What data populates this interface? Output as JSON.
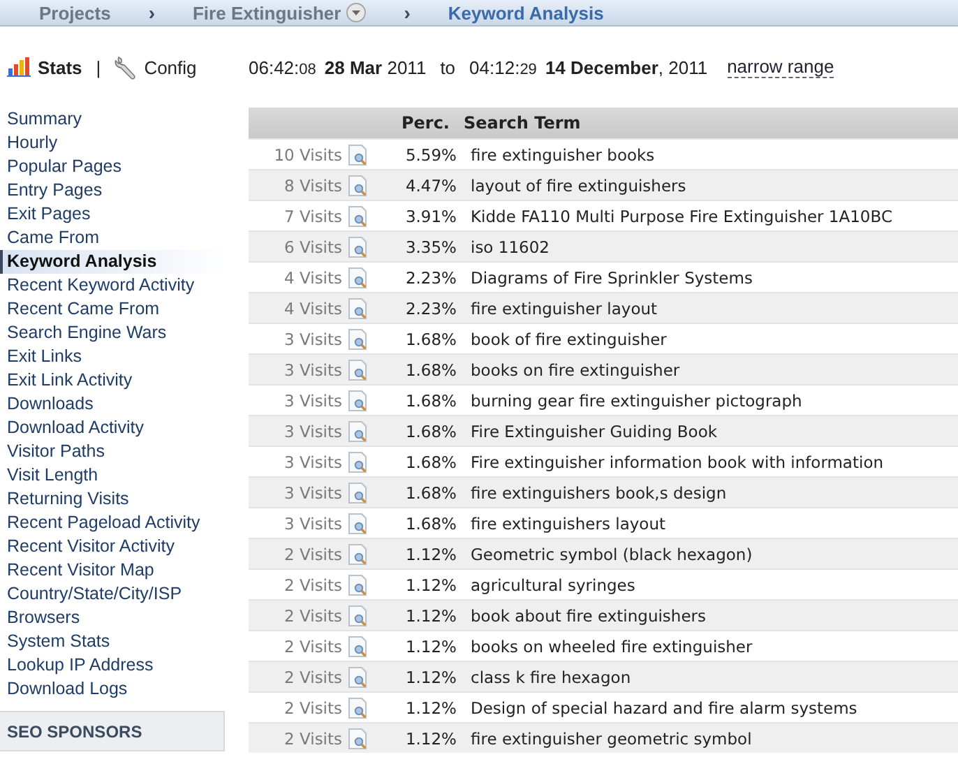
{
  "breadcrumb": [
    {
      "label": "Projects",
      "dropdown": false,
      "selected": false
    },
    {
      "label": "Fire Extinguisher",
      "dropdown": true,
      "selected": false
    },
    {
      "label": "Keyword Analysis",
      "dropdown": false,
      "selected": true
    }
  ],
  "separator": "›",
  "toolbar": {
    "stats": "Stats",
    "divider": "|",
    "config": "Config"
  },
  "range": {
    "start_time": {
      "hm": "06:42:",
      "sec": "08"
    },
    "start_date": "**28 Mar** 2011",
    "to": "to",
    "end_time": {
      "hm": "04:12:",
      "sec": "29"
    },
    "end_date": "**14 December**, 2011",
    "link": "narrow range"
  },
  "sidebar": {
    "items": [
      {
        "label": "Summary",
        "selected": false
      },
      {
        "label": "Hourly",
        "selected": false
      },
      {
        "label": "Popular Pages",
        "selected": false
      },
      {
        "label": "Entry Pages",
        "selected": false
      },
      {
        "label": "Exit Pages",
        "selected": false
      },
      {
        "label": "Came From",
        "selected": false
      },
      {
        "label": "Keyword Analysis",
        "selected": true
      },
      {
        "label": "Recent Keyword Activity",
        "selected": false
      },
      {
        "label": "Recent Came From",
        "selected": false
      },
      {
        "label": "Search Engine Wars",
        "selected": false
      },
      {
        "label": "Exit Links",
        "selected": false
      },
      {
        "label": "Exit Link Activity",
        "selected": false
      },
      {
        "label": "Downloads",
        "selected": false
      },
      {
        "label": "Download Activity",
        "selected": false
      },
      {
        "label": "Visitor Paths",
        "selected": false
      },
      {
        "label": "Visit Length",
        "selected": false
      },
      {
        "label": "Returning Visits",
        "selected": false
      },
      {
        "label": "Recent Pageload Activity",
        "selected": false
      },
      {
        "label": "Recent Visitor Activity",
        "selected": false
      },
      {
        "label": "Recent Visitor Map",
        "selected": false
      },
      {
        "label": "Country/State/City/ISP",
        "selected": false
      },
      {
        "label": "Browsers",
        "selected": false
      },
      {
        "label": "System Stats",
        "selected": false
      },
      {
        "label": "Lookup IP Address",
        "selected": false
      },
      {
        "label": "Download Logs",
        "selected": false
      }
    ],
    "section": "SEO SPONSORS"
  },
  "table": {
    "columns": [
      "Perc.",
      "Search Term"
    ],
    "rows": [
      {
        "visits": "10 Visits",
        "perc": "5.59%",
        "term": "fire extinguisher books"
      },
      {
        "visits": "8 Visits",
        "perc": "4.47%",
        "term": "layout of fire extinguishers"
      },
      {
        "visits": "7 Visits",
        "perc": "3.91%",
        "term": "Kidde FA110 Multi Purpose Fire Extinguisher 1A10BC"
      },
      {
        "visits": "6 Visits",
        "perc": "3.35%",
        "term": "iso 11602"
      },
      {
        "visits": "4 Visits",
        "perc": "2.23%",
        "term": "Diagrams of Fire Sprinkler Systems"
      },
      {
        "visits": "4 Visits",
        "perc": "2.23%",
        "term": "fire extinguisher layout"
      },
      {
        "visits": "3 Visits",
        "perc": "1.68%",
        "term": "book of fire extinguisher"
      },
      {
        "visits": "3 Visits",
        "perc": "1.68%",
        "term": "books on fire extinguisher"
      },
      {
        "visits": "3 Visits",
        "perc": "1.68%",
        "term": "burning gear fire extinguisher pictograph"
      },
      {
        "visits": "3 Visits",
        "perc": "1.68%",
        "term": "Fire Extinguisher Guiding Book"
      },
      {
        "visits": "3 Visits",
        "perc": "1.68%",
        "term": "Fire extinguisher information book with information"
      },
      {
        "visits": "3 Visits",
        "perc": "1.68%",
        "term": "fire extinguishers book,s design"
      },
      {
        "visits": "3 Visits",
        "perc": "1.68%",
        "term": "fire extinguishers layout"
      },
      {
        "visits": "2 Visits",
        "perc": "1.12%",
        "term": "Geometric symbol (black hexagon)"
      },
      {
        "visits": "2 Visits",
        "perc": "1.12%",
        "term": "agricultural syringes"
      },
      {
        "visits": "2 Visits",
        "perc": "1.12%",
        "term": "book about fire extinguishers"
      },
      {
        "visits": "2 Visits",
        "perc": "1.12%",
        "term": "books on wheeled fire extinguisher"
      },
      {
        "visits": "2 Visits",
        "perc": "1.12%",
        "term": "class k fire hexagon"
      },
      {
        "visits": "2 Visits",
        "perc": "1.12%",
        "term": "Design of special hazard and fire alarm systems"
      },
      {
        "visits": "2 Visits",
        "perc": "1.12%",
        "term": "fire extinguisher geometric symbol"
      }
    ]
  }
}
